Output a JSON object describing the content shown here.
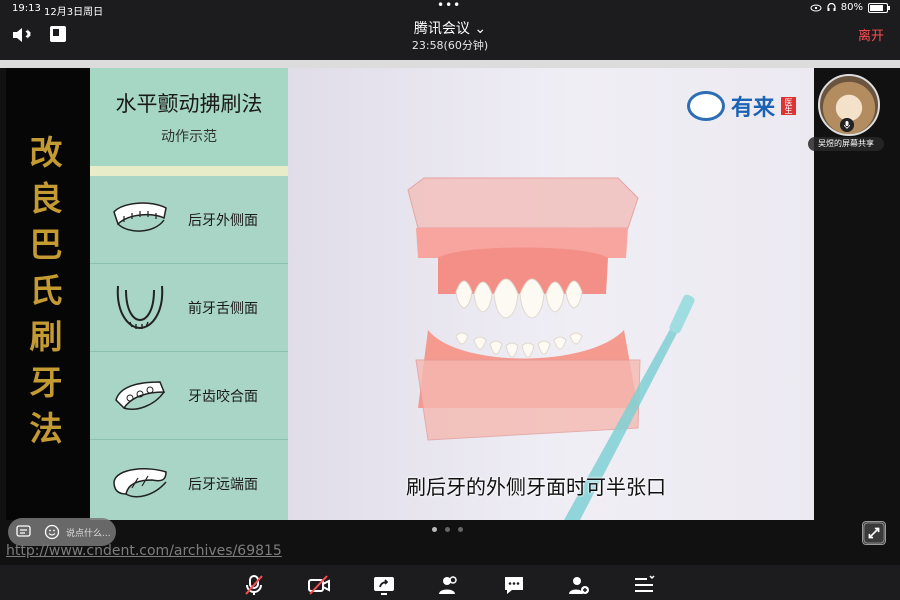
{
  "status_bar": {
    "time": "19:13",
    "date": "12月3日周日",
    "battery": "80%"
  },
  "header": {
    "title": "腾讯会议",
    "duration": "23:58(60分钟)",
    "leave_label": "离开"
  },
  "slide": {
    "vertical_title": "改良巴氏刷牙法",
    "panel_title": "水平颤动拂刷法",
    "panel_subtitle": "动作示范",
    "items": [
      {
        "label": "后牙外侧面",
        "icon": "molar-outer-icon"
      },
      {
        "label": "前牙舌侧面",
        "icon": "front-lingual-icon"
      },
      {
        "label": "牙齿咬合面",
        "icon": "occlusal-icon"
      },
      {
        "label": "后牙远端面",
        "icon": "molar-distal-icon"
      }
    ],
    "brand_text": "有来",
    "brand_tag": "医生",
    "caption": "刷后牙的外侧牙面时可半张口"
  },
  "participant": {
    "share_label": "吴煜的屏幕共享"
  },
  "chat": {
    "placeholder": "说点什么..."
  },
  "url_overlay": "http://www.cndent.com/archives/69815",
  "pager": {
    "count": 3,
    "active": 1
  },
  "colors": {
    "leave": "#ff4d4f",
    "panel": "#a8d5c6",
    "title_gold": "#c49a33"
  }
}
